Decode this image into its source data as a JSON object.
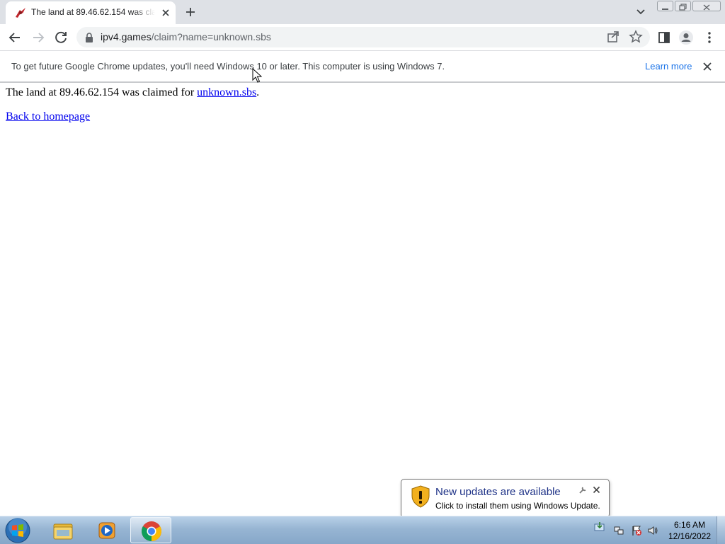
{
  "browser": {
    "tab": {
      "title": "The land at 89.46.62.154 was claimed for unknown.sbs",
      "favicon": "ipv4-games-favicon"
    },
    "new_tab_icon": "plus-icon",
    "address_bar": {
      "host": "ipv4.games",
      "path": "/claim?name=unknown.sbs"
    },
    "infobar": {
      "message": "To get future Google Chrome updates, you'll need Windows 10 or later. This computer is using Windows 7.",
      "link": "Learn more"
    }
  },
  "page": {
    "claim_prefix": "The land at 89.46.62.154 was claimed for ",
    "claim_name": "unknown.sbs",
    "claim_suffix": ".",
    "back_link": "Back to homepage"
  },
  "notification": {
    "title": "New updates are available",
    "subtitle": "Click to install them using Windows Update."
  },
  "taskbar": {
    "apps": [
      "windows-explorer",
      "windows-media-player",
      "google-chrome"
    ],
    "active_app": "google-chrome",
    "clock": {
      "time": "6:16 AM",
      "date": "12/16/2022"
    }
  },
  "colors": {
    "link": "#0000ee",
    "chrome_tabstrip": "#dee1e6",
    "infobar_link": "#1a73e8",
    "notification_title": "#1e3287"
  }
}
